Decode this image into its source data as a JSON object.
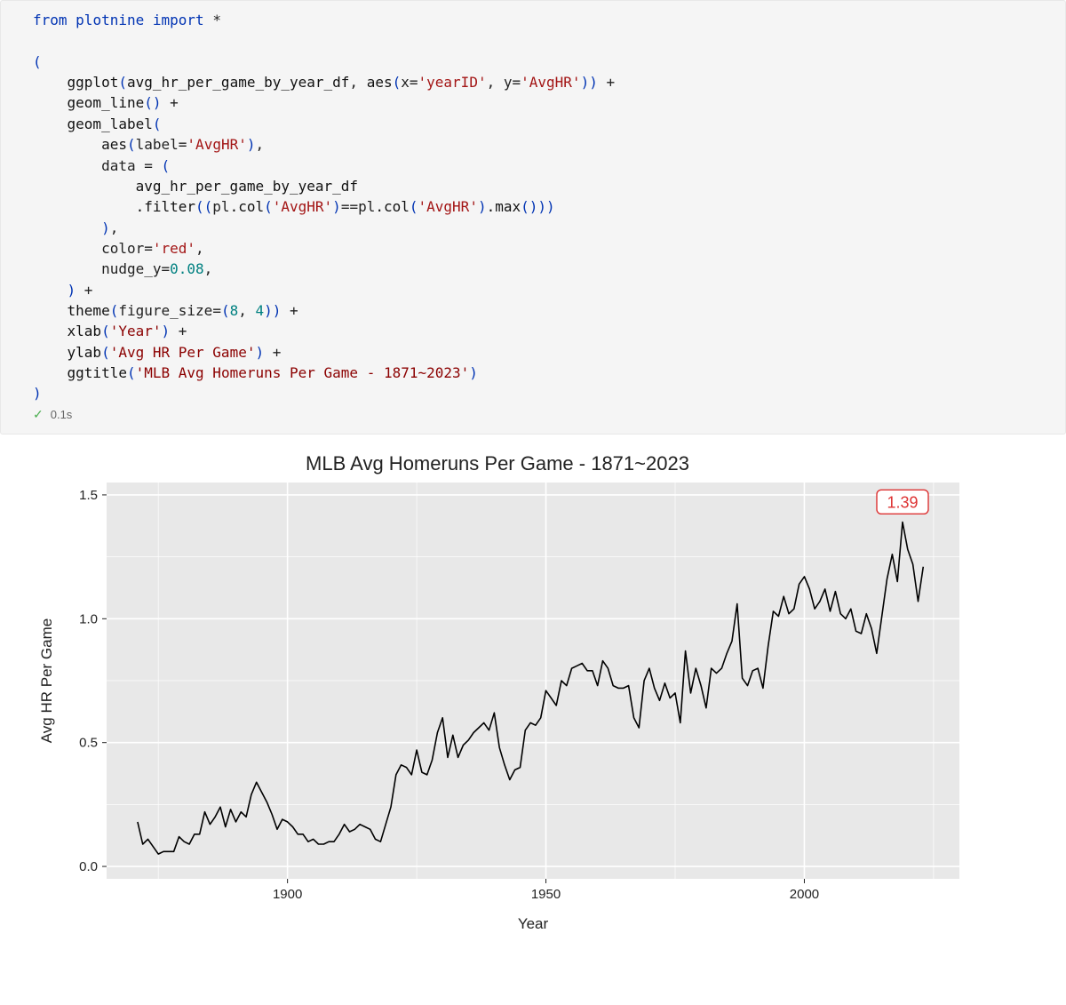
{
  "cell": {
    "exec_status_icon": "check",
    "exec_time": "0.1s"
  },
  "code": {
    "l1_from": "from",
    "l1_mod": "plotnine",
    "l1_import": "import",
    "l1_star": "*",
    "l3_open": "(",
    "l4_ggplot": "ggplot",
    "l4_df": "avg_hr_per_game_by_year_df",
    "l4_aes": "aes",
    "l4_x": "x",
    "l4_xval": "'yearID'",
    "l4_y": "y",
    "l4_yval": "'AvgHR'",
    "l5_geomline": "geom_line",
    "l6_geomlabel": "geom_label",
    "l7_aes": "aes",
    "l7_label": "label",
    "l7_labelval": "'AvgHR'",
    "l8_data": "data",
    "l9_df": "avg_hr_per_game_by_year_df",
    "l10_filter": ".filter",
    "l10_pl1": "pl",
    "l10_col1": ".col",
    "l10_arg1": "'AvgHR'",
    "l10_eq": "==",
    "l10_pl2": "pl",
    "l10_col2": ".col",
    "l10_arg2": "'AvgHR'",
    "l10_max": ".max",
    "l12_color": "color",
    "l12_colorval": "'red'",
    "l13_nudge": "nudge_y",
    "l13_nudgeval": "0.08",
    "l15_theme": "theme",
    "l15_fig": "figure_size",
    "l15_n1": "8",
    "l15_n2": "4",
    "l16_xlab": "xlab",
    "l16_xlabval": "'Year'",
    "l17_ylab": "ylab",
    "l17_ylabval": "'Avg HR Per Game'",
    "l18_ggtitle": "ggtitle",
    "l18_titleval": "'MLB Avg Homeruns Per Game - 1871~2023'",
    "l19_close": ")"
  },
  "chart_data": {
    "type": "line",
    "title": "MLB Avg Homeruns Per Game - 1871~2023",
    "xlabel": "Year",
    "ylabel": "Avg HR Per Game",
    "xlim": [
      1865,
      2030
    ],
    "ylim": [
      -0.05,
      1.55
    ],
    "x_ticks": [
      1900,
      1950,
      2000
    ],
    "y_ticks": [
      0.0,
      0.5,
      1.0,
      1.5
    ],
    "max_label": "1.39",
    "max_point": {
      "x": 2019,
      "y": 1.39
    },
    "x": [
      1871,
      1872,
      1873,
      1874,
      1875,
      1876,
      1877,
      1878,
      1879,
      1880,
      1881,
      1882,
      1883,
      1884,
      1885,
      1886,
      1887,
      1888,
      1889,
      1890,
      1891,
      1892,
      1893,
      1894,
      1895,
      1896,
      1897,
      1898,
      1899,
      1900,
      1901,
      1902,
      1903,
      1904,
      1905,
      1906,
      1907,
      1908,
      1909,
      1910,
      1911,
      1912,
      1913,
      1914,
      1915,
      1916,
      1917,
      1918,
      1919,
      1920,
      1921,
      1922,
      1923,
      1924,
      1925,
      1926,
      1927,
      1928,
      1929,
      1930,
      1931,
      1932,
      1933,
      1934,
      1935,
      1936,
      1937,
      1938,
      1939,
      1940,
      1941,
      1942,
      1943,
      1944,
      1945,
      1946,
      1947,
      1948,
      1949,
      1950,
      1951,
      1952,
      1953,
      1954,
      1955,
      1956,
      1957,
      1958,
      1959,
      1960,
      1961,
      1962,
      1963,
      1964,
      1965,
      1966,
      1967,
      1968,
      1969,
      1970,
      1971,
      1972,
      1973,
      1974,
      1975,
      1976,
      1977,
      1978,
      1979,
      1980,
      1981,
      1982,
      1983,
      1984,
      1985,
      1986,
      1987,
      1988,
      1989,
      1990,
      1991,
      1992,
      1993,
      1994,
      1995,
      1996,
      1997,
      1998,
      1999,
      2000,
      2001,
      2002,
      2003,
      2004,
      2005,
      2006,
      2007,
      2008,
      2009,
      2010,
      2011,
      2012,
      2013,
      2014,
      2015,
      2016,
      2017,
      2018,
      2019,
      2020,
      2021,
      2022,
      2023
    ],
    "y": [
      0.18,
      0.09,
      0.11,
      0.08,
      0.05,
      0.06,
      0.06,
      0.06,
      0.12,
      0.1,
      0.09,
      0.13,
      0.13,
      0.22,
      0.17,
      0.2,
      0.24,
      0.16,
      0.23,
      0.18,
      0.22,
      0.2,
      0.29,
      0.34,
      0.3,
      0.26,
      0.21,
      0.15,
      0.19,
      0.18,
      0.16,
      0.13,
      0.13,
      0.1,
      0.11,
      0.09,
      0.09,
      0.1,
      0.1,
      0.13,
      0.17,
      0.14,
      0.15,
      0.17,
      0.16,
      0.15,
      0.11,
      0.1,
      0.17,
      0.24,
      0.37,
      0.41,
      0.4,
      0.37,
      0.47,
      0.38,
      0.37,
      0.43,
      0.54,
      0.6,
      0.44,
      0.53,
      0.44,
      0.49,
      0.51,
      0.54,
      0.56,
      0.58,
      0.55,
      0.62,
      0.48,
      0.41,
      0.35,
      0.39,
      0.4,
      0.55,
      0.58,
      0.57,
      0.6,
      0.71,
      0.68,
      0.65,
      0.75,
      0.73,
      0.8,
      0.81,
      0.82,
      0.79,
      0.79,
      0.73,
      0.83,
      0.8,
      0.73,
      0.72,
      0.72,
      0.73,
      0.6,
      0.56,
      0.75,
      0.8,
      0.72,
      0.67,
      0.74,
      0.68,
      0.7,
      0.58,
      0.87,
      0.7,
      0.8,
      0.73,
      0.64,
      0.8,
      0.78,
      0.8,
      0.86,
      0.91,
      1.06,
      0.76,
      0.73,
      0.79,
      0.8,
      0.72,
      0.89,
      1.03,
      1.01,
      1.09,
      1.02,
      1.04,
      1.14,
      1.17,
      1.12,
      1.04,
      1.07,
      1.12,
      1.03,
      1.11,
      1.02,
      1.0,
      1.04,
      0.95,
      0.94,
      1.02,
      0.96,
      0.86,
      1.01,
      1.16,
      1.26,
      1.15,
      1.39,
      1.28,
      1.22,
      1.07,
      1.21
    ]
  }
}
